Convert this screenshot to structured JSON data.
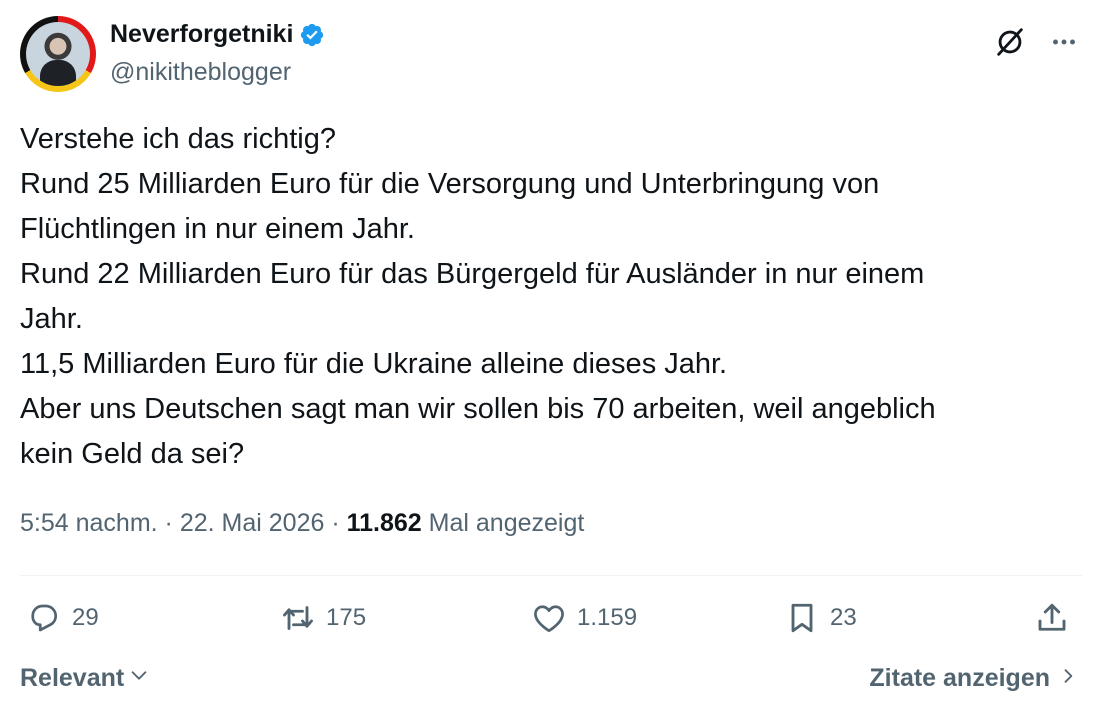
{
  "author": {
    "display_name": "Neverforgetniki",
    "handle": "@nikitheblogger",
    "verified": true,
    "verified_color": "#1d9bf0"
  },
  "top_actions": {
    "grok_icon": "grok-icon",
    "more_icon": "more-icon"
  },
  "tweet": {
    "lines": [
      "Verstehe ich das richtig?",
      "Rund 25 Milliarden Euro für die Versorgung und Unterbringung von",
      "Flüchtlingen in nur einem Jahr.",
      "Rund 22 Milliarden Euro für das Bürgergeld für Ausländer in nur einem",
      "Jahr.",
      "11,5 Milliarden Euro für die Ukraine alleine dieses Jahr.",
      "Aber uns Deutschen sagt man wir sollen bis 70 arbeiten, weil angeblich",
      "kein Geld da sei?"
    ]
  },
  "meta": {
    "time": "5:54 nachm.",
    "separator": "·",
    "date": "22. Mai 2026",
    "views_count": "11.862",
    "views_label": "Mal angezeigt"
  },
  "actions": {
    "replies": "29",
    "reposts": "175",
    "likes": "1.159",
    "bookmarks": "23"
  },
  "footer": {
    "sort_label": "Relevant",
    "quotes_label": "Zitate anzeigen"
  },
  "colors": {
    "text": "#0f1419",
    "secondary": "#536471",
    "divider": "#eff3f4",
    "avatar_ring": [
      "#e11919",
      "#f5c518",
      "#111111"
    ]
  }
}
